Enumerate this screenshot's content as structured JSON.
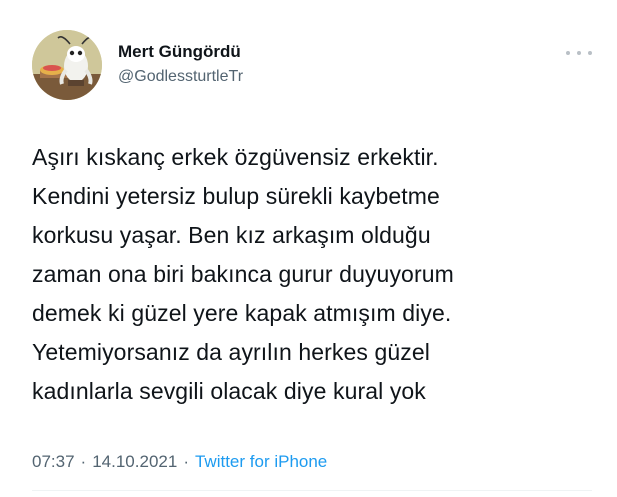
{
  "author": {
    "display_name": "Mert Güngördü",
    "handle": "@GodlessturtleTr",
    "avatar_icon": "cartoon-avatar"
  },
  "menu": {
    "icon": "more-options-icon"
  },
  "tweet": {
    "text": "Aşırı kıskanç erkek özgüvensiz erkektir.\nKendini yetersiz bulup sürekli kaybetme\nkorkusu yaşar. Ben kız arkaşım olduğu\nzaman ona biri bakınca gurur duyuyorum\ndemek ki güzel yere kapak atmışım diye.\nYetemiyorsanız da ayrılın herkes güzel\nkadınlarla sevgili olacak diye kural yok"
  },
  "meta": {
    "time": "07:37",
    "separator": "·",
    "date": "14.10.2021",
    "source": "Twitter for iPhone"
  },
  "colors": {
    "text": "#0f1419",
    "secondary": "#536471",
    "link": "#1d9bf0"
  }
}
